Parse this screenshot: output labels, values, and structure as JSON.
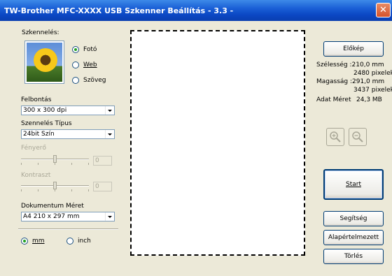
{
  "window": {
    "title": "TW-Brother  MFC-XXXX  USB Szkenner Beállítás - 3.3 -",
    "close_glyph": "✕"
  },
  "scan": {
    "label": "Szkennelés:",
    "options": [
      {
        "label": "Fotó",
        "checked": true
      },
      {
        "label": "Web",
        "checked": false
      },
      {
        "label": "Szöveg",
        "checked": false
      }
    ],
    "thumbnail_icon": "sunflower-photo-icon"
  },
  "resolution": {
    "label": "Felbontás",
    "value": "300 x 300 dpi"
  },
  "scan_type": {
    "label": "Szennelés Típus",
    "value": "24bit Szín"
  },
  "brightness": {
    "label": "Fényerő",
    "value": "0",
    "level": 0.5
  },
  "contrast": {
    "label": "Kontraszt",
    "value": "0",
    "level": 0.5
  },
  "doc_size": {
    "label": "Dokumentum Méret",
    "value": "A4 210 x 297 mm"
  },
  "units": {
    "options": [
      {
        "label": "mm",
        "checked": true
      },
      {
        "label": "inch",
        "checked": false
      }
    ]
  },
  "right": {
    "preview_button": "Előkép",
    "width_label": "Szélesség :210,0 mm",
    "width_px": "2480 pixelek",
    "height_label": "Magasság :291,0 mm",
    "height_px": "3437 pixelek",
    "data_size_label": "Adat Méret",
    "data_size_value": "24,3 MB",
    "zoom_in_icon": "zoom-in-icon",
    "zoom_out_icon": "zoom-out-icon",
    "start_button": "Start",
    "help_button": "Segítség",
    "default_button": "Alapértelmezett",
    "delete_button": "Törlés"
  }
}
